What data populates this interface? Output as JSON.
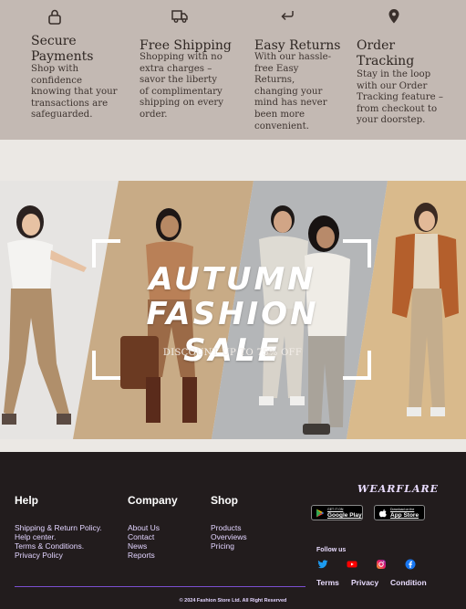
{
  "features": [
    {
      "icon": "lock-icon",
      "title_lines": [
        "Secure",
        "Payments"
      ],
      "desc": "Shop with confidence knowing that your transactions are safeguarded."
    },
    {
      "icon": "truck-icon",
      "title_lines": [
        "Free Shipping"
      ],
      "desc": "Shopping with no extra charges – savor the liberty of complimentary shipping on every order."
    },
    {
      "icon": "return-arrow-icon",
      "title_lines": [
        "Easy Returns"
      ],
      "desc": "With our hassle-free Easy Returns, changing your mind has never been more convenient."
    },
    {
      "icon": "map-pin-icon",
      "title_lines": [
        "Order",
        "Tracking"
      ],
      "desc": "Stay in the loop with our Order Tracking feature – from checkout to your doorstep."
    }
  ],
  "banner": {
    "title_line1": "AUTUMN",
    "title_line2": "FASHION SALE",
    "subtitle": "DISCOUNT UP TO 75% OFF"
  },
  "footer": {
    "help": {
      "title": "Help",
      "links": [
        "Shipping & Return Policy.",
        "Help center.",
        "Terms & Conditions.",
        "Privacy Policy"
      ]
    },
    "company": {
      "title": "Company",
      "links": [
        "About Us",
        "Contact",
        "News",
        "Reports"
      ]
    },
    "shop": {
      "title": "Shop",
      "links": [
        "Products",
        "Overviews",
        "Pricing"
      ]
    },
    "brand": "WEARFLARE",
    "google_play": {
      "small": "GET IT ON",
      "big": "Google Play"
    },
    "app_store": {
      "small": "Download on the",
      "big": "App Store"
    },
    "follow_label": "Follow us",
    "social_icons": [
      "twitter-icon",
      "youtube-icon",
      "instagram-icon",
      "facebook-icon"
    ],
    "bottom_links": [
      "Terms",
      "Privacy",
      "Condition"
    ],
    "copyright": "© 2024 Fashion Store Ltd. All Right Reserved"
  },
  "colors": {
    "features_bg": "#c3b9b3",
    "footer_bg": "#221c1d",
    "footer_link": "#e2d4ff",
    "divider": "#7b4fd1"
  }
}
